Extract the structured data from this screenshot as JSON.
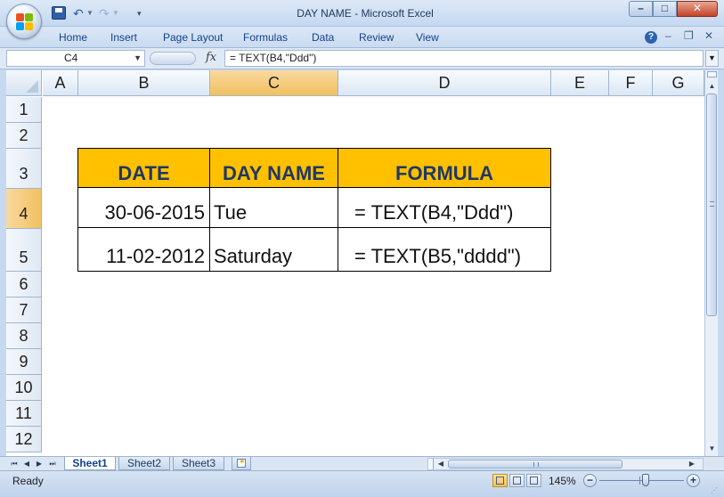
{
  "window": {
    "title": "DAY NAME - Microsoft Excel"
  },
  "ribbon": {
    "tabs": [
      "Home",
      "Insert",
      "Page Layout",
      "Formulas",
      "Data",
      "Review",
      "View"
    ],
    "help": "?"
  },
  "formula_bar": {
    "name_box": "C4",
    "fx": "fx",
    "formula": "= TEXT(B4,\"Ddd\")"
  },
  "grid": {
    "columns": [
      "A",
      "B",
      "C",
      "D",
      "E",
      "F",
      "G"
    ],
    "selected_column": "C",
    "rows": [
      "1",
      "2",
      "3",
      "4",
      "5",
      "6",
      "7",
      "8",
      "9",
      "10",
      "11",
      "12"
    ],
    "selected_row": "4",
    "table": {
      "headers": [
        "DATE",
        "DAY NAME",
        "FORMULA"
      ],
      "rows": [
        [
          "30-06-2015",
          "Tue",
          "= TEXT(B4,\"Ddd\")"
        ],
        [
          "11-02-2012",
          "Saturday",
          "= TEXT(B5,\"dddd\")"
        ]
      ],
      "header_fill": "#FFC000",
      "header_text_color": "#1F3864"
    }
  },
  "sheets": {
    "tabs": [
      "Sheet1",
      "Sheet2",
      "Sheet3"
    ],
    "active": "Sheet1"
  },
  "status": {
    "mode": "Ready",
    "zoom": "145%"
  }
}
